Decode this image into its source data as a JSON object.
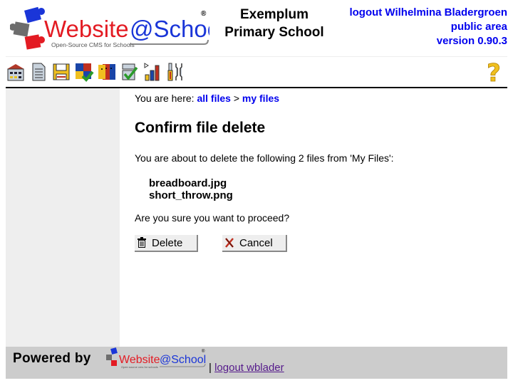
{
  "header": {
    "logo_alt": "Website@School Open-Source CMS for Schools",
    "logo_main_red": "Website",
    "logo_main_blue": "@School",
    "logo_tagline": "Open-Source CMS for Schools",
    "site_title_line1": "Exemplum",
    "site_title_line2": "Primary School",
    "logout_link": "logout Wilhelmina Bladergroen",
    "area_link": "public area",
    "version_link": "version 0.90.3"
  },
  "toolbar": {
    "icons": [
      "start-center-icon",
      "page-manager-icon",
      "file-manager-icon",
      "modules-icon",
      "account-manager-icon",
      "configuration-wizard-icon",
      "statistics-icon",
      "tools-icon"
    ],
    "help_icon": "help-icon"
  },
  "breadcrumb": {
    "prefix": "You are here:",
    "items": [
      "all files",
      "my files"
    ],
    "separator": ">"
  },
  "main": {
    "title": "Confirm file delete",
    "intro": "You are about to delete the following 2 files from 'My Files':",
    "files": [
      "breadboard.jpg",
      "short_throw.png"
    ],
    "confirm_question": "Are you sure you want to proceed?",
    "delete_label": "Delete",
    "cancel_label": "Cancel"
  },
  "footer": {
    "powered_by": "Powered by",
    "logo_red": "Website",
    "logo_blue": "@School",
    "logo_tagline": "Open source cms for schools",
    "separator": "|",
    "logout_link": "logout wblader"
  },
  "colors": {
    "link": "#0000ee",
    "visited_link": "#551a8b",
    "sidebar_bg": "#eeeeee",
    "footer_bg": "#cccccc",
    "logo_red": "#e31b23",
    "logo_blue": "#1a35d8"
  }
}
